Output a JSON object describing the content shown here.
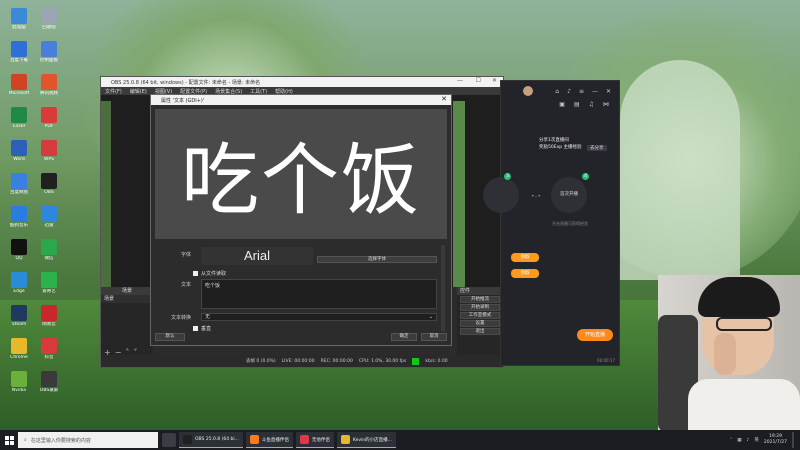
{
  "desktop": {
    "icons": [
      {
        "label": "此电脑",
        "color": "#3a8ad8"
      },
      {
        "label": "回收站",
        "color": "#9aa6b2"
      },
      {
        "label": "百度下载",
        "color": "#2f6fd6"
      },
      {
        "label": "控制面板",
        "color": "#4a7fd8"
      },
      {
        "label": "Microsoft",
        "color": "#d04424"
      },
      {
        "label": "腾讯视频",
        "color": "#e0552b"
      },
      {
        "label": "Excel",
        "color": "#1f8a45"
      },
      {
        "label": "PDF",
        "color": "#d93a3a"
      },
      {
        "label": "Word",
        "color": "#2b5fb8"
      },
      {
        "label": "WPS",
        "color": "#d43b3b"
      },
      {
        "label": "百度网盘",
        "color": "#3a80e0"
      },
      {
        "label": "OBS",
        "color": "#202020"
      },
      {
        "label": "酷狗音乐",
        "color": "#2a7de0"
      },
      {
        "label": "迅雷",
        "color": "#2e86de"
      },
      {
        "label": "QQ",
        "color": "#111111"
      },
      {
        "label": "微信",
        "color": "#2aa84a"
      },
      {
        "label": "Edge",
        "color": "#2a8cd8"
      },
      {
        "label": "爱奇艺",
        "color": "#2bb24a"
      },
      {
        "label": "Steam",
        "color": "#1e3a5e"
      },
      {
        "label": "网易云",
        "color": "#c8282c"
      },
      {
        "label": "Chrome",
        "color": "#e6b82a"
      },
      {
        "label": "抖音",
        "color": "#d83a3a"
      },
      {
        "label": "Nvidia",
        "color": "#6bb03a"
      },
      {
        "label": "OBS录屏",
        "color": "#3a3a3a"
      }
    ]
  },
  "obs": {
    "title": "OBS 25.0.8 (64 bit, windows) - 配置文件: 未命名 - 场景: 未命名",
    "menu": [
      "文件(F)",
      "编辑(E)",
      "视图(V)",
      "配置文件(P)",
      "场景集合(S)",
      "工具(T)",
      "帮助(H)"
    ],
    "scenes_header": "场景",
    "scene_item": "场景",
    "controls_header": "控件",
    "controls": [
      "开始推流",
      "开始录制",
      "工作室模式",
      "设置",
      "退出"
    ],
    "status": {
      "dropped": "丢帧 0 (0.0%)",
      "live": "LIVE: 00:00:00",
      "rec": "REC: 00:00:00",
      "cpu": "CPU: 1.0%, 30.00 fps",
      "kbps": "kb/s: 0.00"
    }
  },
  "dialog": {
    "title": "属性 '文本 (GDI+)'",
    "preview_text": "吃个饭",
    "font_label": "字体",
    "font_value": "Arial",
    "select_font": "选择字体",
    "from_file": "从文件读取",
    "text_label": "文本",
    "text_value": "吃个饭",
    "direction_label": "文本转换",
    "direction_value": "无",
    "vertical": "垂直",
    "defaults": "默认",
    "ok": "确定",
    "cancel": "取消"
  },
  "stream": {
    "task_title": "分享1次直播间",
    "task_reward": "奖励50Exp 主播经验",
    "go_btn": "去分享",
    "step_label": "首次开播",
    "step_num": "4",
    "step_sub": "开启直播可获得经验",
    "green_num": "3",
    "claim": "领取",
    "go_live": "开始直播",
    "footer": "00:00:17"
  },
  "taskbar": {
    "search_placeholder": "在这里输入你要搜索的内容",
    "apps": [
      {
        "label": "OBS 25.0.8 (64 bi...",
        "color": "#202020"
      },
      {
        "label": "斗鱼直播伴侣",
        "color": "#ff7a1a"
      },
      {
        "label": "无他伴侣",
        "color": "#e0384a"
      },
      {
        "label": "Kevin的小店直播...",
        "color": "#e6b82a"
      }
    ],
    "tray_lang": "英",
    "time": "19:29",
    "date": "2021/7/27"
  }
}
